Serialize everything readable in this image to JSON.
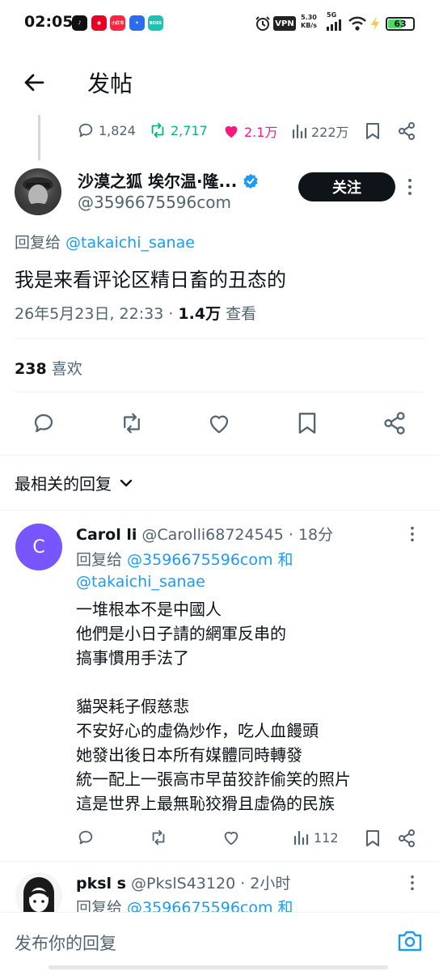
{
  "status_bar": {
    "time": "02:05",
    "app_icons": [
      {
        "name": "tiktok-icon",
        "label": "♪",
        "color": "#111111"
      },
      {
        "name": "netease-music-icon",
        "label": "◉",
        "color": "#e60026"
      },
      {
        "name": "xiaohongshu-icon",
        "label": "小红书",
        "color": "#ff2442"
      },
      {
        "name": "app-store-icon",
        "label": "✦",
        "color": "#2b6cf0"
      },
      {
        "name": "boss-zhipin-icon",
        "label": "BOSS",
        "color": "#1fc2b2"
      }
    ],
    "vpn": "VPN",
    "net_speed_value": "5.30",
    "net_speed_unit": "KB/s",
    "network": "5G",
    "battery": "63",
    "battery_level_pct": 63
  },
  "header": {
    "title": "发帖"
  },
  "parent_stats": {
    "replies": "1,824",
    "reposts": "2,717",
    "likes": "2.1万",
    "views": "222万"
  },
  "tweet": {
    "author_name": "沙漠之狐 埃尔温·隆...",
    "handle": "@3596675596com",
    "follow_label": "关注",
    "replying_prefix": "回复给 ",
    "replying_to": "@takaichi_sanae",
    "text": "我是来看评论区精日畜的丑态的",
    "timestamp": "26年5月23日, 22:33 · ",
    "views_count": "1.4万",
    "views_label": " 查看",
    "likes_count": "238",
    "likes_label": " 喜欢"
  },
  "sort": {
    "label": "最相关的回复"
  },
  "replies": [
    {
      "avatar_letter": "C",
      "name": "Carol li",
      "handle_time": " @Carolli68724545 · 18分",
      "replying_prefix": "回复给 ",
      "replying_to_1": "@3596675596com",
      "replying_and": " 和",
      "replying_to_2": "@takaichi_sanae",
      "text": "一堆根本不是中國人\n他們是小日子請的網軍反串的\n搞事慣用手法了\n\n貓哭耗子假慈悲\n不安好心的虛偽炒作，吃人血饅頭\n她發出後日本所有媒體同時轉發\n統一配上一張高市早苗狡詐偷笑的照片\n這是世界上最無恥狡猾且虛偽的民族",
      "views": "112"
    },
    {
      "name": "pksl s",
      "handle_time": " @PkslS43120 · 2小时",
      "replying_prefix": "回复给 ",
      "replying_to_1": "@3596675596com",
      "replying_and": " 和"
    }
  ],
  "composer": {
    "placeholder": "发布你的回复"
  },
  "colors": {
    "accent": "#1d9bf0",
    "repost_green": "#00ba7c",
    "like_pink": "#f91880",
    "muted": "#536471"
  }
}
